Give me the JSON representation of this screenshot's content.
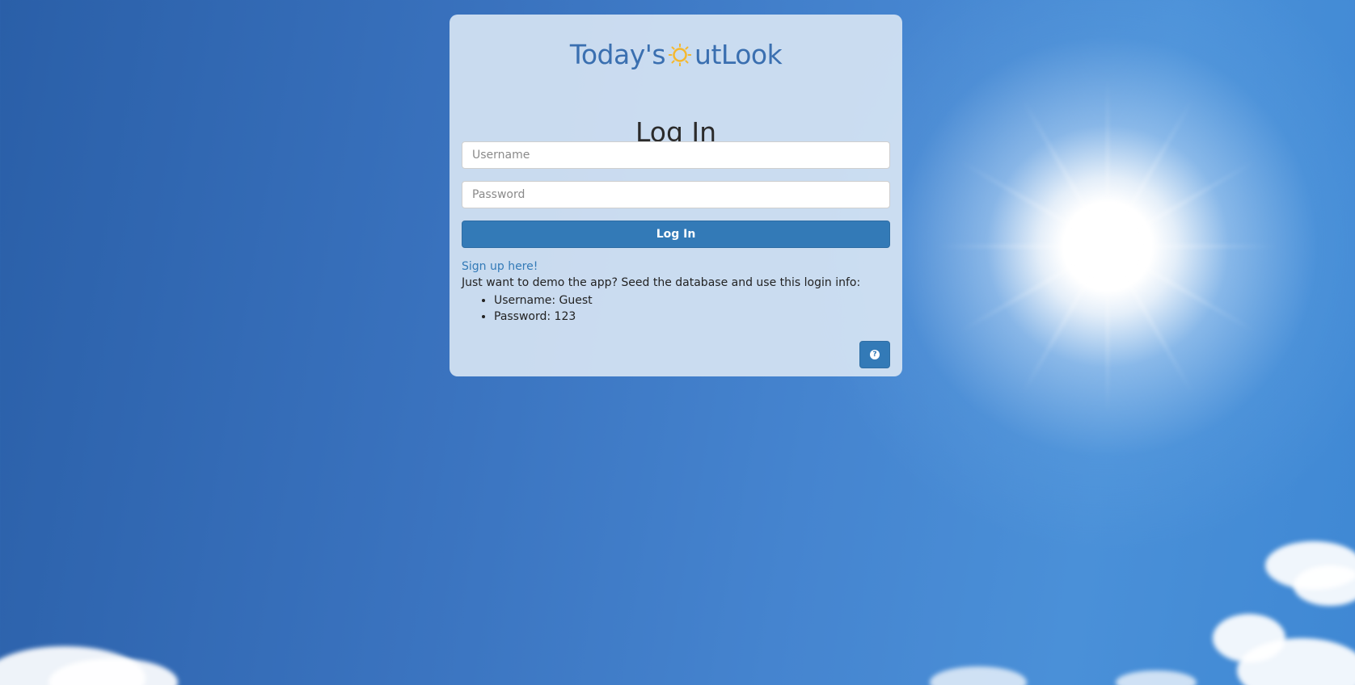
{
  "brand": {
    "logo_part1": "Today's",
    "logo_part2": "utLook",
    "logo_color": "#3a6fb0",
    "sun_color": "#f5b82e"
  },
  "login": {
    "title": "Log In",
    "username_placeholder": "Username",
    "password_placeholder": "Password",
    "submit_label": "Log In",
    "signup_link": "Sign up here!",
    "demo_intro": "Just want to demo the app? Seed the database and use this login info:",
    "demo_credentials": [
      "Username: Guest",
      "Password: 123"
    ]
  },
  "help": {
    "icon": "question-circle-icon"
  },
  "colors": {
    "primary": "#337ab7",
    "link": "#337ab7",
    "card_background": "#d6e4f3"
  }
}
